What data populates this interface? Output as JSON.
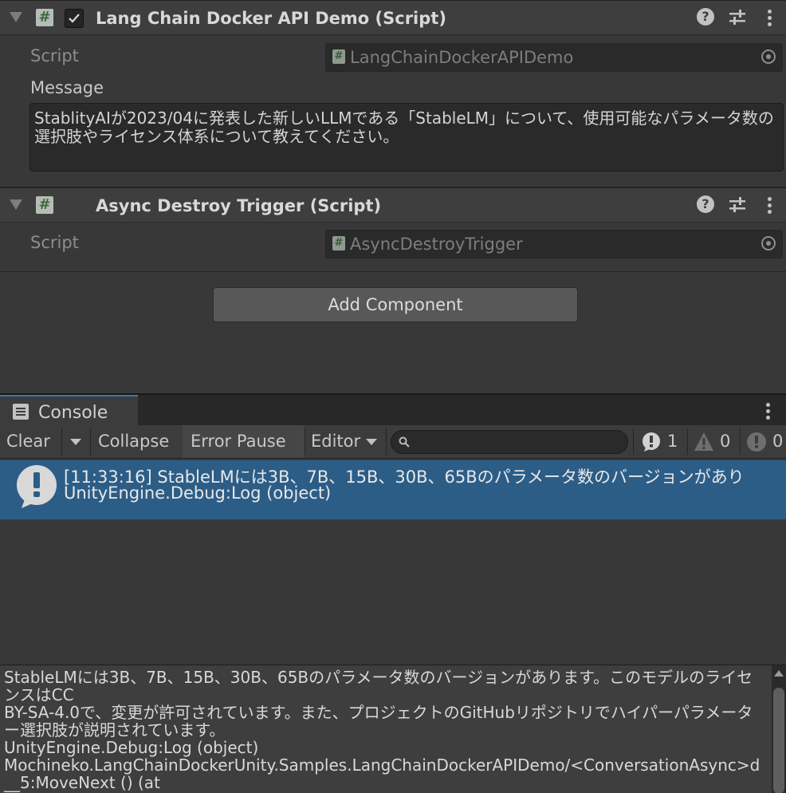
{
  "components": [
    {
      "title": "Lang Chain Docker API Demo (Script)",
      "enabled_checkbox": true,
      "script_label": "Script",
      "script_value": "LangChainDockerAPIDemo",
      "message_label": "Message",
      "message_value": "StablityAIが2023/04に発表した新しいLLMである「StableLM」について、使用可能なパラメータ数の選択肢やライセンス体系について教えてください。"
    },
    {
      "title": "Async Destroy Trigger (Script)",
      "script_label": "Script",
      "script_value": "AsyncDestroyTrigger"
    }
  ],
  "add_component_label": "Add Component",
  "console": {
    "tab_label": "Console",
    "toolbar": {
      "clear": "Clear",
      "collapse": "Collapse",
      "error_pause": "Error Pause",
      "editor": "Editor",
      "search_placeholder": ""
    },
    "counts": {
      "log": "1",
      "warning": "0",
      "error": "0"
    },
    "entries": [
      {
        "line1": "[11:33:16] StableLMには3B、7B、15B、30B、65Bのパラメータ数のバージョンがあり",
        "line2": "UnityEngine.Debug:Log (object)"
      }
    ],
    "detail": "StableLMには3B、7B、15B、30B、65Bのパラメータ数のバージョンがあります。このモデルのライセンスはCC\nBY-SA-4.0で、変更が許可されています。また、プロジェクトのGitHubリポジトリでハイパーパラメーター選択肢が説明されています。\nUnityEngine.Debug:Log (object)\nMochineko.LangChainDockerUnity.Samples.LangChainDockerAPIDemo/<ConversationAsync>d__5:MoveNext () (at"
  },
  "colors": {
    "background": "#383838",
    "selected_row": "#2c5d87",
    "tab_accent": "#3a79bb"
  }
}
